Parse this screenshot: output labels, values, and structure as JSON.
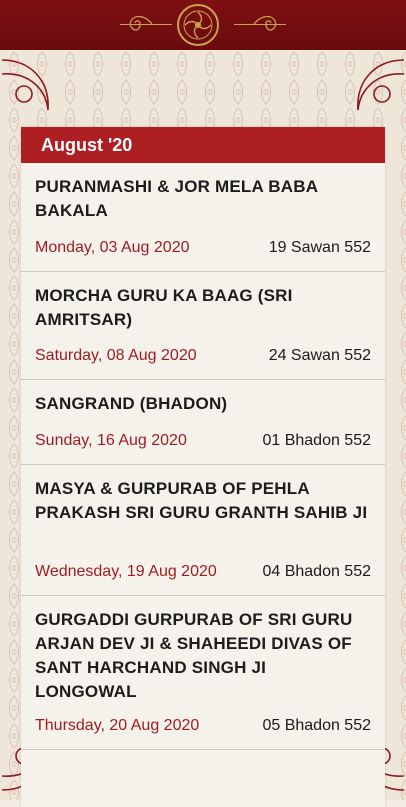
{
  "header": {
    "month_label": "August '20"
  },
  "events": [
    {
      "title": "PURANMASHI & JOR MELA BABA BAKALA",
      "date": "Monday, 03 Aug 2020",
      "nanakshahi": "19 Sawan 552"
    },
    {
      "title": "MORCHA GURU KA BAAG (SRI AMRITSAR)",
      "date": "Saturday, 08 Aug 2020",
      "nanakshahi": "24 Sawan 552"
    },
    {
      "title": "SANGRAND (BHADON)",
      "date": "Sunday, 16 Aug 2020",
      "nanakshahi": "01 Bhadon 552"
    },
    {
      "title": "MASYA & GURPURAB OF PEHLA PRAKASH SRI GURU GRANTH SAHIB JI",
      "date": "Wednesday, 19 Aug 2020",
      "nanakshahi": "04 Bhadon 552"
    },
    {
      "title": "GURGADDI GURPURAB OF SRI GURU ARJAN DEV JI & SHAHEEDI DIVAS OF SANT HARCHAND SINGH JI LONGOWAL",
      "date": "Thursday, 20 Aug 2020",
      "nanakshahi": "05 Bhadon 552"
    }
  ],
  "colors": {
    "topbar": "#7e0f12",
    "header_bar": "#ae1f23",
    "date_text": "#9e1b1f",
    "gold_ornament": "#c9a24e"
  },
  "icons": {
    "emblem": "ik-onkar-emblem-icon",
    "ornament": "floral-swirl-icon"
  }
}
